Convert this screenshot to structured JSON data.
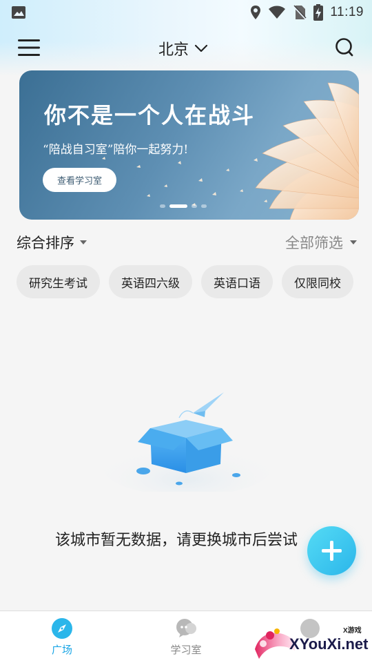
{
  "status_bar": {
    "time": "11:19"
  },
  "header": {
    "city": "北京"
  },
  "banner": {
    "title": "你不是一个人在战斗",
    "subtitle": "“陪战自习室”陪你一起努力!",
    "button_label": "查看学习室"
  },
  "filters": {
    "sort_label": "综合排序",
    "filter_label": "全部筛选"
  },
  "chips": [
    "研究生考试",
    "英语四六级",
    "英语口语",
    "仅限同校"
  ],
  "empty_state": {
    "message": "该城市暂无数据，请更换城市后尝试"
  },
  "bottom_nav": {
    "items": [
      {
        "label": "广场",
        "icon": "compass-icon",
        "active": true
      },
      {
        "label": "学习室",
        "icon": "chat-bubbles-icon",
        "active": false
      },
      {
        "label": "",
        "icon": "profile-icon",
        "active": false
      }
    ]
  },
  "watermark": {
    "text": "XYouXi.net",
    "small": "X游戏"
  },
  "colors": {
    "accent": "#2bb6ea",
    "active_tab": "#1aa6e6",
    "inactive_tab": "#888888"
  }
}
